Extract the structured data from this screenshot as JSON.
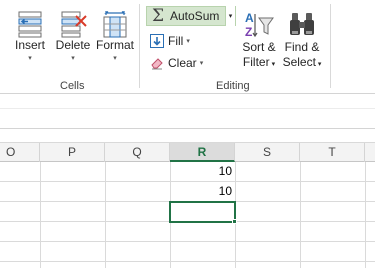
{
  "ribbon": {
    "cells": {
      "group_label": "Cells",
      "insert_label": "Insert",
      "delete_label": "Delete",
      "format_label": "Format"
    },
    "editing": {
      "group_label": "Editing",
      "autosum_label": "AutoSum",
      "fill_label": "Fill",
      "clear_label": "Clear",
      "sort_label_1": "Sort &",
      "sort_label_2": "Filter",
      "find_label_1": "Find &",
      "find_label_2": "Select"
    },
    "dropdown_glyph": "▾",
    "sigma_glyph": "Σ"
  },
  "grid": {
    "columns": [
      "O",
      "P",
      "Q",
      "R",
      "S",
      "T"
    ],
    "selected_column": "R",
    "cells": [
      {
        "col": "R",
        "row_index": 0,
        "value": "10"
      },
      {
        "col": "R",
        "row_index": 1,
        "value": "10"
      }
    ],
    "active_cell": {
      "col": "R",
      "row_index": 2
    }
  },
  "colors": {
    "accent": "#217346",
    "autosum_bg": "#d5e6cf"
  }
}
